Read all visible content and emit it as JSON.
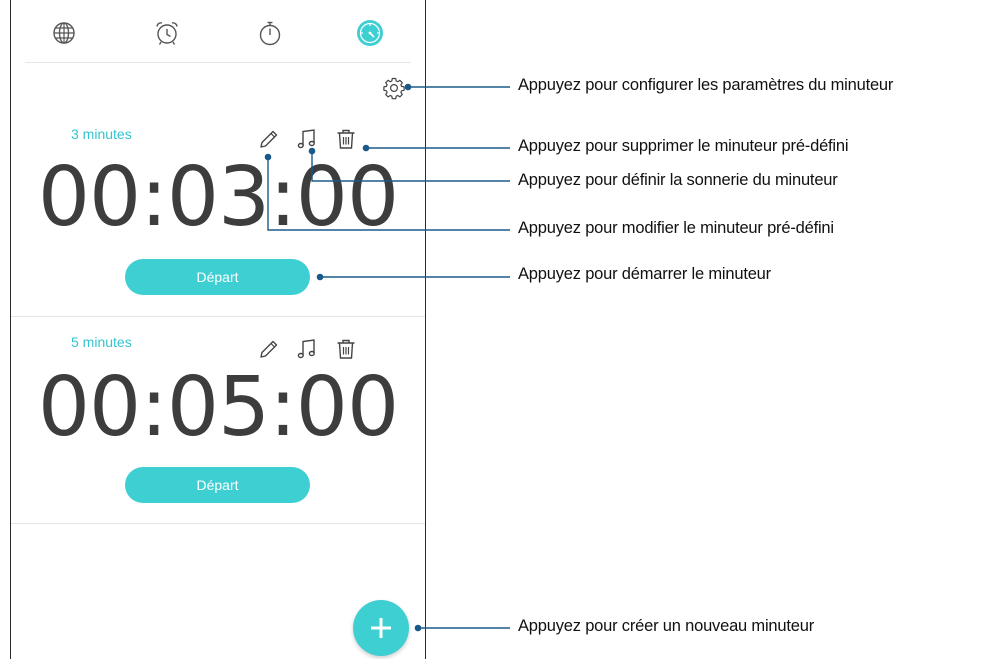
{
  "tabs": [
    {
      "name": "world-clock",
      "icon": "globe-icon",
      "active": false
    },
    {
      "name": "alarm",
      "icon": "alarm-clock-icon",
      "active": false
    },
    {
      "name": "stopwatch",
      "icon": "stopwatch-icon",
      "active": false
    },
    {
      "name": "timer",
      "icon": "timer-icon",
      "active": true
    }
  ],
  "settings_icon": "gear-icon",
  "timers": [
    {
      "label": "3 minutes",
      "value": "00:03:00",
      "start_label": "Départ"
    },
    {
      "label": "5 minutes",
      "value": "00:05:00",
      "start_label": "Départ"
    }
  ],
  "fab_icon": "plus-icon",
  "callouts": {
    "settings": "Appuyez pour configurer les paramètres du minuteur",
    "delete": "Appuyez pour supprimer le minuteur pré-défini",
    "ringtone": "Appuyez pour définir la sonnerie du minuteur",
    "edit": "Appuyez pour modifier le minuteur pré-défini",
    "start": "Appuyez pour démarrer le minuteur",
    "create": "Appuyez pour créer un nouveau minuteur"
  },
  "colors": {
    "accent": "#3ecfd2",
    "label_accent": "#35c5cf",
    "leader_line": "#1a5a8a"
  }
}
